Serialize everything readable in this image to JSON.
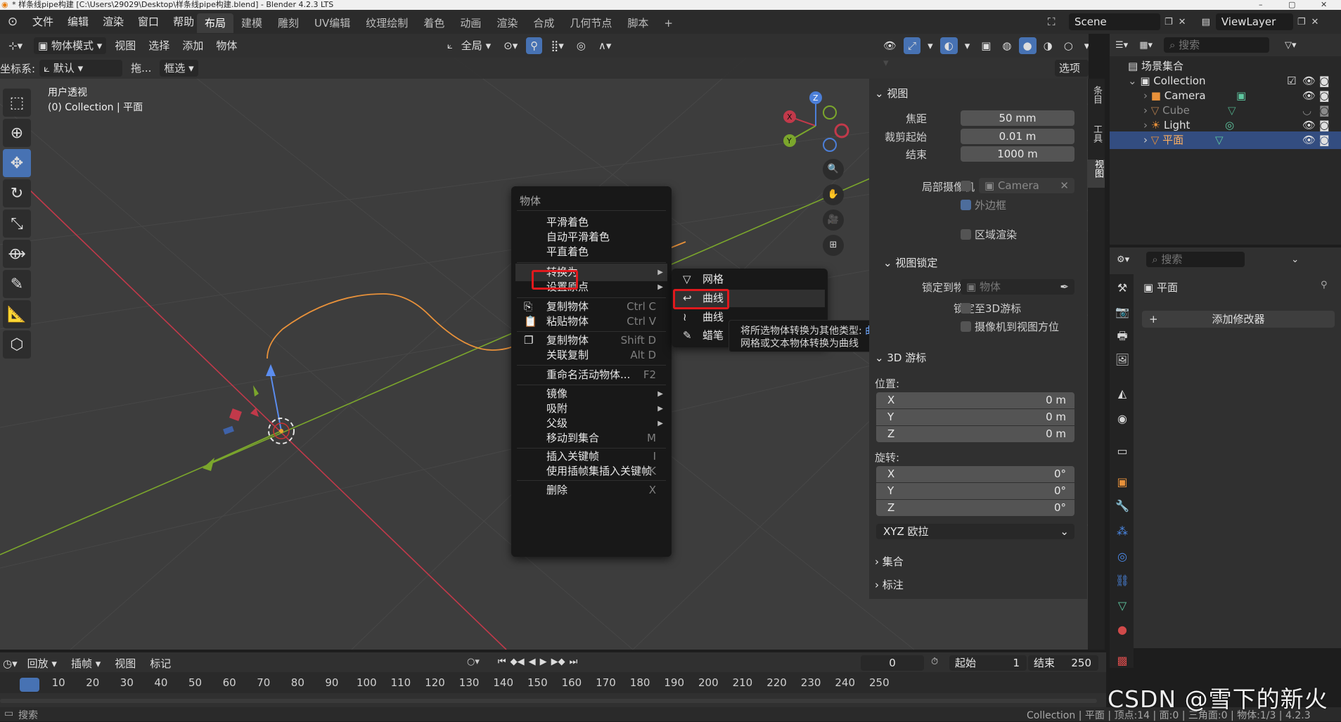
{
  "window": {
    "title": "* 样条线pipe构建 [C:\\Users\\29029\\Desktop\\样条线pipe构建.blend] - Blender 4.2.3 LTS"
  },
  "topbar": {
    "menus": [
      "文件",
      "编辑",
      "渲染",
      "窗口",
      "帮助"
    ],
    "workspaces": [
      "布局",
      "建模",
      "雕刻",
      "UV编辑",
      "纹理绘制",
      "着色",
      "动画",
      "渲染",
      "合成",
      "几何节点",
      "脚本"
    ],
    "add_tab": "+",
    "scene": "Scene",
    "view_layer": "ViewLayer"
  },
  "viewport": {
    "mode": "物体模式",
    "menus": [
      "视图",
      "选择",
      "添加",
      "物体"
    ],
    "transform_orientation": "全局",
    "coord_label": "坐标系:",
    "coord_value": "默认",
    "drag_label": "拖...",
    "select_mode": "框选",
    "options": "选项",
    "view_name": "用户透视",
    "collection_info": "(0) Collection | 平面"
  },
  "gizmo": {
    "x": "X",
    "y": "Y",
    "z": "Z"
  },
  "context_menu": {
    "title": "物体",
    "items": [
      {
        "label": "平滑着色",
        "shortcut": ""
      },
      {
        "label": "自动平滑着色",
        "shortcut": ""
      },
      {
        "label": "平直着色",
        "shortcut": ""
      },
      {
        "label": "转换为",
        "shortcut": ""
      },
      {
        "label": "设置原点",
        "shortcut": ""
      },
      {
        "label": "复制物体",
        "shortcut": "Ctrl C"
      },
      {
        "label": "粘贴物体",
        "shortcut": "Ctrl V"
      },
      {
        "label": "复制物体",
        "shortcut": "Shift D"
      },
      {
        "label": "关联复制",
        "shortcut": "Alt D"
      },
      {
        "label": "重命名活动物体...",
        "shortcut": "F2"
      },
      {
        "label": "镜像",
        "shortcut": ""
      },
      {
        "label": "吸附",
        "shortcut": ""
      },
      {
        "label": "父级",
        "shortcut": ""
      },
      {
        "label": "移动到集合",
        "shortcut": "M"
      },
      {
        "label": "插入关键帧",
        "shortcut": "I"
      },
      {
        "label": "使用插帧集插入关键帧",
        "shortcut": "K"
      },
      {
        "label": "删除",
        "shortcut": "X"
      }
    ]
  },
  "submenu": {
    "items": [
      "网格",
      "曲线",
      "曲线",
      "蜡笔"
    ]
  },
  "tooltip": {
    "line1": "将所选物体转换为其他类型: ",
    "line1_highlight": "曲线",
    "line2": "网格或文本物体转换为曲线"
  },
  "npanel": {
    "view_section": "视图",
    "focal_label": "焦距",
    "focal_value": "50 mm",
    "clip_start_label": "裁剪起始",
    "clip_start_value": "0.01 m",
    "clip_end_label": "结束",
    "clip_end_value": "1000 m",
    "local_camera_label": "局部摄像机",
    "camera_value": "Camera",
    "border_label": "外边框",
    "region_render_label": "区域渲染",
    "view_lock_section": "视图锁定",
    "lock_to_object_label": "锁定到物体",
    "lock_object_placeholder": "物体",
    "lock_label": "锁定",
    "to_3d_cursor": "至3D游标",
    "camera_to_view": "摄像机到视图方位",
    "cursor_section": "3D 游标",
    "location_label": "位置:",
    "loc": [
      {
        "axis": "X",
        "value": "0 m"
      },
      {
        "axis": "Y",
        "value": "0 m"
      },
      {
        "axis": "Z",
        "value": "0 m"
      }
    ],
    "rotation_label": "旋转:",
    "rot": [
      {
        "axis": "X",
        "value": "0°"
      },
      {
        "axis": "Y",
        "value": "0°"
      },
      {
        "axis": "Z",
        "value": "0°"
      }
    ],
    "rotation_mode": "XYZ 欧拉",
    "collections_section": "集合",
    "annotations_section": "标注",
    "side_tabs": [
      "条目",
      "工具",
      "视图"
    ]
  },
  "outliner": {
    "search_placeholder": "搜索",
    "scene_collection": "场景集合",
    "collection": "Collection",
    "items": [
      "Camera",
      "Cube",
      "Light",
      "平面"
    ]
  },
  "properties": {
    "search_placeholder": "搜索",
    "object_name": "平面",
    "add_modifier": "添加修改器"
  },
  "timeline": {
    "menus": [
      "回放",
      "插帧",
      "视图",
      "标记"
    ],
    "current_frame": "0",
    "start_label": "起始",
    "start_value": "1",
    "end_label": "结束",
    "end_value": "250",
    "ticks": [
      "0",
      "10",
      "20",
      "30",
      "40",
      "50",
      "60",
      "70",
      "80",
      "90",
      "100",
      "110",
      "120",
      "130",
      "140",
      "150",
      "160",
      "170",
      "180",
      "190",
      "200",
      "210",
      "220",
      "230",
      "240",
      "250"
    ]
  },
  "status": {
    "search": "搜索",
    "info": "Collection | 平面 | 顶点:14 | 面:0 | 三角面:0 | 物体:1/3 | 4.2.3"
  },
  "watermark": "CSDN @雪下的新火",
  "colors": {
    "accent_blue": "#4772b3",
    "highlight_red": "#e0191d",
    "selection": "#334d80"
  }
}
